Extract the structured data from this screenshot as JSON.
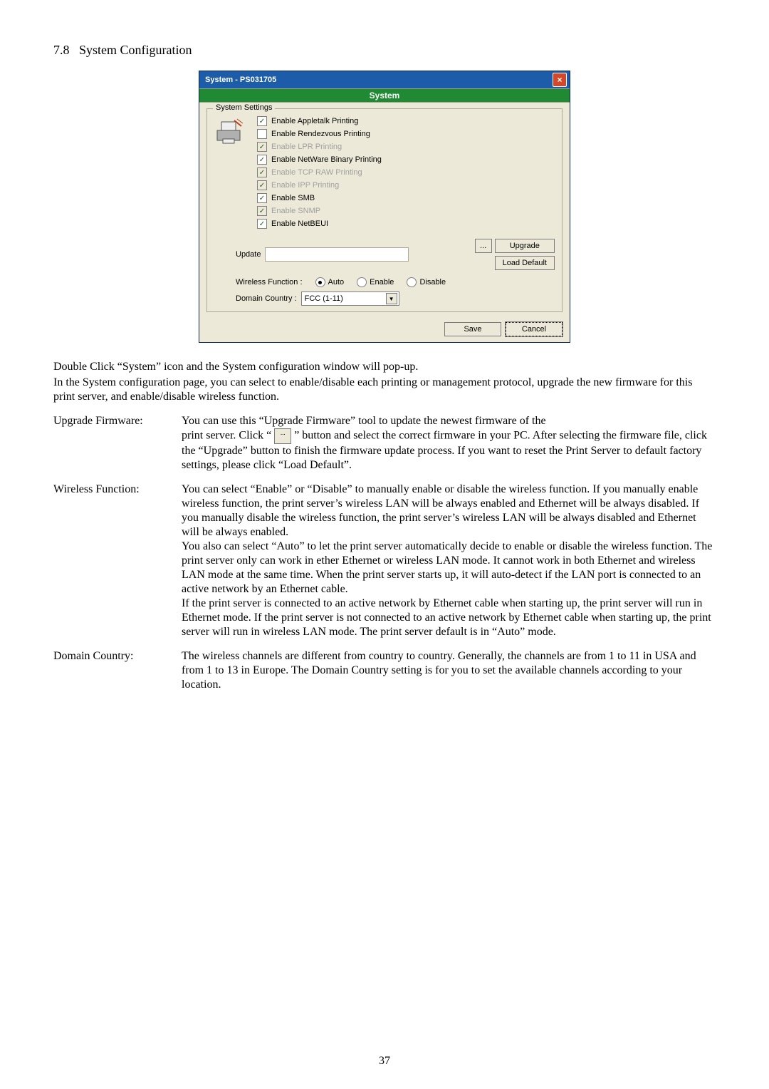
{
  "section_number": "7.8",
  "section_title": "System Configuration",
  "dialog": {
    "title": "System - PS031705",
    "strip_text": "System",
    "group_legend": "System Settings",
    "checks": [
      {
        "label": "Enable Appletalk Printing",
        "checked": true,
        "dim": false
      },
      {
        "label": "Enable Rendezvous Printing",
        "checked": false,
        "dim": false
      },
      {
        "label": "Enable LPR Printing",
        "checked": true,
        "dim": true
      },
      {
        "label": "Enable NetWare Binary Printing",
        "checked": true,
        "dim": false
      },
      {
        "label": "Enable TCP RAW Printing",
        "checked": true,
        "dim": true
      },
      {
        "label": "Enable IPP Printing",
        "checked": true,
        "dim": true
      },
      {
        "label": "Enable SMB",
        "checked": true,
        "dim": false
      },
      {
        "label": "Enable SNMP",
        "checked": true,
        "dim": true
      },
      {
        "label": "Enable NetBEUI",
        "checked": true,
        "dim": false
      }
    ],
    "update_label": "Update",
    "browse_label": "...",
    "upgrade_label": "Upgrade",
    "load_default_label": "Load Default",
    "wireless_label": "Wireless Function :",
    "wf_opts": {
      "auto": "Auto",
      "enable": "Enable",
      "disable": "Disable"
    },
    "domain_label": "Domain Country :",
    "domain_value": "FCC (1-11)",
    "save_label": "Save",
    "cancel_label": "Cancel"
  },
  "para1": "Double Click “System” icon and the System configuration window will pop-up.",
  "para2": "In the System configuration page, you can select to enable/disable each printing or management protocol, upgrade the new firmware for this print server, and enable/disable wireless function.",
  "upgrade_fw": {
    "label": "Upgrade Firmware:",
    "text_a": "You can use this “Upgrade Firmware” tool to update the newest firmware of the",
    "text_b": "print server. Click “",
    "text_c": "” button and select the correct firmware in your PC. After selecting the firmware file, click the “Upgrade” button to finish the firmware update process. If you want to reset the Print Server to default factory settings, please click “Load Default”."
  },
  "wireless_fn": {
    "label": "Wireless Function:",
    "text": "You can select “Enable” or “Disable” to manually enable or disable the wireless function. If you manually enable wireless function, the print server’s wireless LAN will be always enabled and Ethernet will be always disabled. If you manually disable the wireless function, the print server’s wireless LAN will be always disabled and Ethernet will be always enabled.\nYou also can select “Auto” to let the print server automatically decide to enable or disable the wireless function. The print server only can work in ether Ethernet or wireless LAN mode. It cannot work in both Ethernet and wireless LAN mode at the same time. When the print server starts up, it will auto-detect if the LAN port is connected to an active network by an Ethernet cable.\nIf the print server is connected to an active network by Ethernet cable when starting up, the print server will run in Ethernet mode. If the print server is not connected to an active network by Ethernet cable when starting up, the print server will run in wireless LAN mode. The print server default is in “Auto” mode."
  },
  "domain_country": {
    "label": "Domain Country:",
    "text": "The wireless channels are different from country to country. Generally, the channels are from 1 to 11 in USA and from 1 to 13 in Europe. The Domain Country setting is for you to set the available channels according to your location."
  },
  "page_number": "37"
}
